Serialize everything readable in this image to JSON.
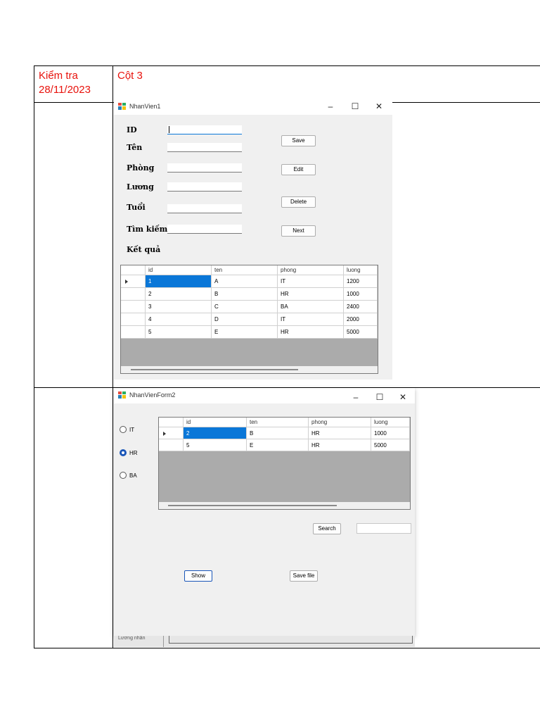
{
  "doc": {
    "header_col1": [
      "Kiểm tra",
      "28/11/2023"
    ],
    "header_col2": "Cột 3"
  },
  "form1": {
    "title": "NhanVien1",
    "controls": {
      "minimize": "–",
      "maximize": "☐",
      "close": "✕"
    },
    "labels": {
      "id": "ID",
      "ten": "Tên",
      "phong": "Phòng",
      "luong": "Lương",
      "tuoi": "Tuổi",
      "timkiem": "Tìm kiếm",
      "ketqua": "Kết quả"
    },
    "buttons": {
      "save": "Save",
      "edit": "Edit",
      "delete": "Delete",
      "next": "Next"
    },
    "grid": {
      "columns": [
        "id",
        "ten",
        "phong",
        "luong"
      ],
      "rows": [
        [
          "1",
          "A",
          "IT",
          "1200"
        ],
        [
          "2",
          "B",
          "HR",
          "1000"
        ],
        [
          "3",
          "C",
          "BA",
          "2400"
        ],
        [
          "4",
          "D",
          "IT",
          "2000"
        ],
        [
          "5",
          "E",
          "HR",
          "5000"
        ]
      ]
    }
  },
  "form2": {
    "title": "NhanVienForm2",
    "controls": {
      "minimize": "–",
      "maximize": "☐",
      "close": "✕"
    },
    "radios": [
      {
        "label": "IT",
        "checked": false
      },
      {
        "label": "HR",
        "checked": true
      },
      {
        "label": "BA",
        "checked": false
      }
    ],
    "grid": {
      "columns": [
        "id",
        "ten",
        "phong",
        "luong"
      ],
      "rows": [
        [
          "2",
          "B",
          "HR",
          "1000"
        ],
        [
          "5",
          "E",
          "HR",
          "5000"
        ]
      ]
    },
    "buttons": {
      "search": "Search",
      "show": "Show",
      "savefile": "Save file"
    },
    "search_value": "",
    "behind_text": "Lương nhân"
  },
  "colors": {
    "header_red": "#e8120c",
    "selection_blue": "#0a77d8",
    "grid_bg": "#ababab"
  }
}
